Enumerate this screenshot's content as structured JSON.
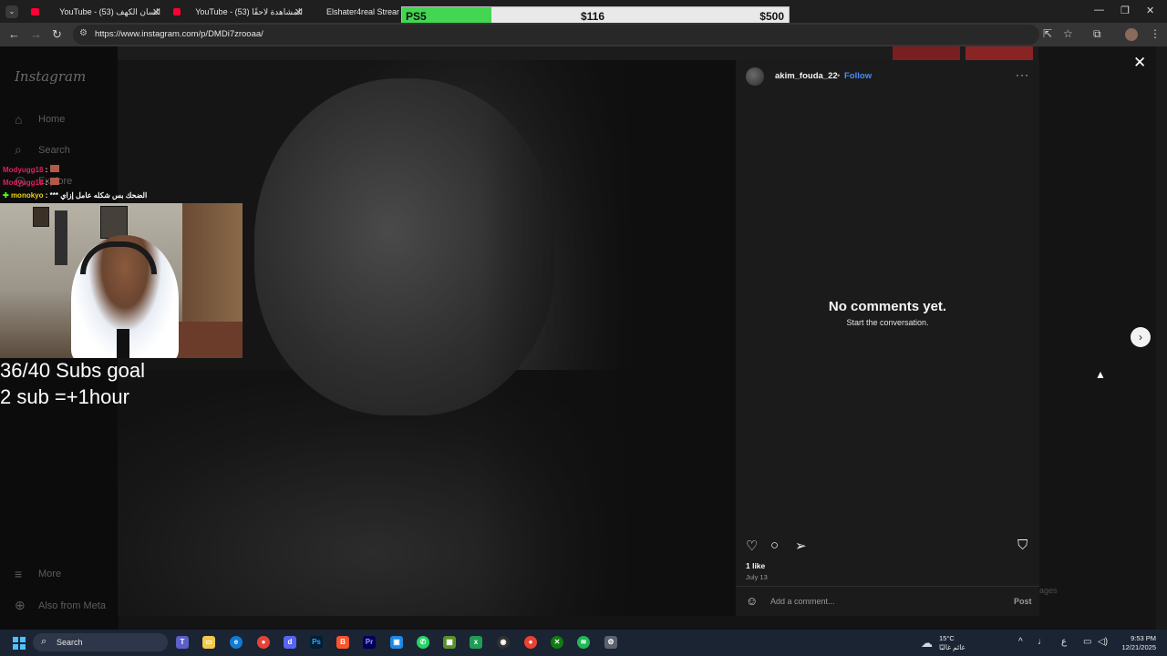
{
  "browser": {
    "tabs": [
      {
        "label": "YouTube - السان الكهف (53)",
        "color": "#ff0033"
      },
      {
        "label": "YouTube - المشاهدة لاحقًا (53)",
        "color": "#ff0033"
      },
      {
        "label": "Elshater4real Stream",
        "color": "#53fc18"
      }
    ],
    "url": "https://www.instagram.com/p/DMDi7zrooaa/"
  },
  "goal_bar": {
    "label": "PS5",
    "current": "$116",
    "target": "$500",
    "progress_fraction": 0.23,
    "fill_color": "#42d652"
  },
  "instagram": {
    "logo": "Instagram",
    "nav": {
      "home": "Home",
      "search": "Search",
      "explore": "Explore",
      "more": "More",
      "meta": "Also from Meta"
    },
    "post": {
      "username": "akim_fouda_22",
      "separator": "•",
      "follow": "Follow",
      "more": "···",
      "empty_title": "No comments yet.",
      "empty_sub": "Start the conversation.",
      "likes": "1 like",
      "date": "July 13",
      "comment_placeholder": "Add a comment...",
      "post_button": "Post"
    },
    "messages": "ages"
  },
  "stream": {
    "chat": [
      {
        "name": "Modyugg18",
        "sep": " :",
        "msg": ""
      },
      {
        "name": "Modyugg18",
        "sep": " :",
        "msg": ""
      },
      {
        "name": "monokyo",
        "sep": " :",
        "msg": "*** الضحك بس شكله عامل إزاي"
      }
    ],
    "subs_goal": "36/40 Subs goal",
    "subs_rule": "2 sub =+1hour"
  },
  "taskbar": {
    "search_label": "Search",
    "weather_temp": "15°C",
    "weather_desc": "غائم غالبًا",
    "time": "9:53 PM",
    "date": "12/21/2025"
  }
}
